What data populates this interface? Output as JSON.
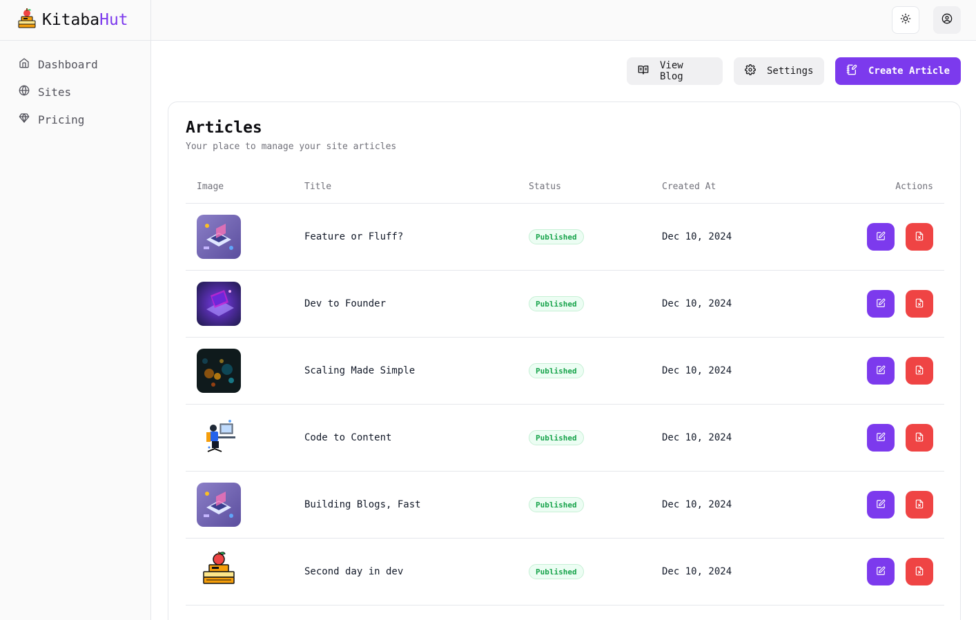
{
  "brand": {
    "name_main": "Kitaba",
    "name_accent": "Hut",
    "accent_color": "#7c3aed"
  },
  "sidebar": {
    "items": [
      {
        "label": "Dashboard",
        "icon": "home-icon"
      },
      {
        "label": "Sites",
        "icon": "globe-icon"
      },
      {
        "label": "Pricing",
        "icon": "diamond-icon"
      }
    ]
  },
  "header": {
    "theme_icon": "sun-icon",
    "user_icon": "user-circle-icon"
  },
  "toolbar": {
    "view_blog_label": "View Blog",
    "settings_label": "Settings",
    "create_article_label": "Create Article"
  },
  "articles": {
    "title": "Articles",
    "subtitle": "Your place to manage your site articles",
    "columns": {
      "image": "Image",
      "title": "Title",
      "status": "Status",
      "created_at": "Created At",
      "actions": "Actions"
    },
    "rows": [
      {
        "title": "Feature or Fluff?",
        "status": "Published",
        "created_at": "Dec 10, 2024",
        "thumb": "isometric-laptop"
      },
      {
        "title": "Dev to Founder",
        "status": "Published",
        "created_at": "Dec 10, 2024",
        "thumb": "purple-laptop"
      },
      {
        "title": "Scaling Made Simple",
        "status": "Published",
        "created_at": "Dec 10, 2024",
        "thumb": "bokeh-dark"
      },
      {
        "title": "Code to Content",
        "status": "Published",
        "created_at": "Dec 10, 2024",
        "thumb": "developer-desk"
      },
      {
        "title": "Building Blogs, Fast",
        "status": "Published",
        "created_at": "Dec 10, 2024",
        "thumb": "isometric-laptop"
      },
      {
        "title": "Second day in dev",
        "status": "Published",
        "created_at": "Dec 10, 2024",
        "thumb": "books-apple"
      }
    ]
  },
  "colors": {
    "primary": "#7c3aed",
    "danger": "#ef4444",
    "success": "#16a34a"
  }
}
